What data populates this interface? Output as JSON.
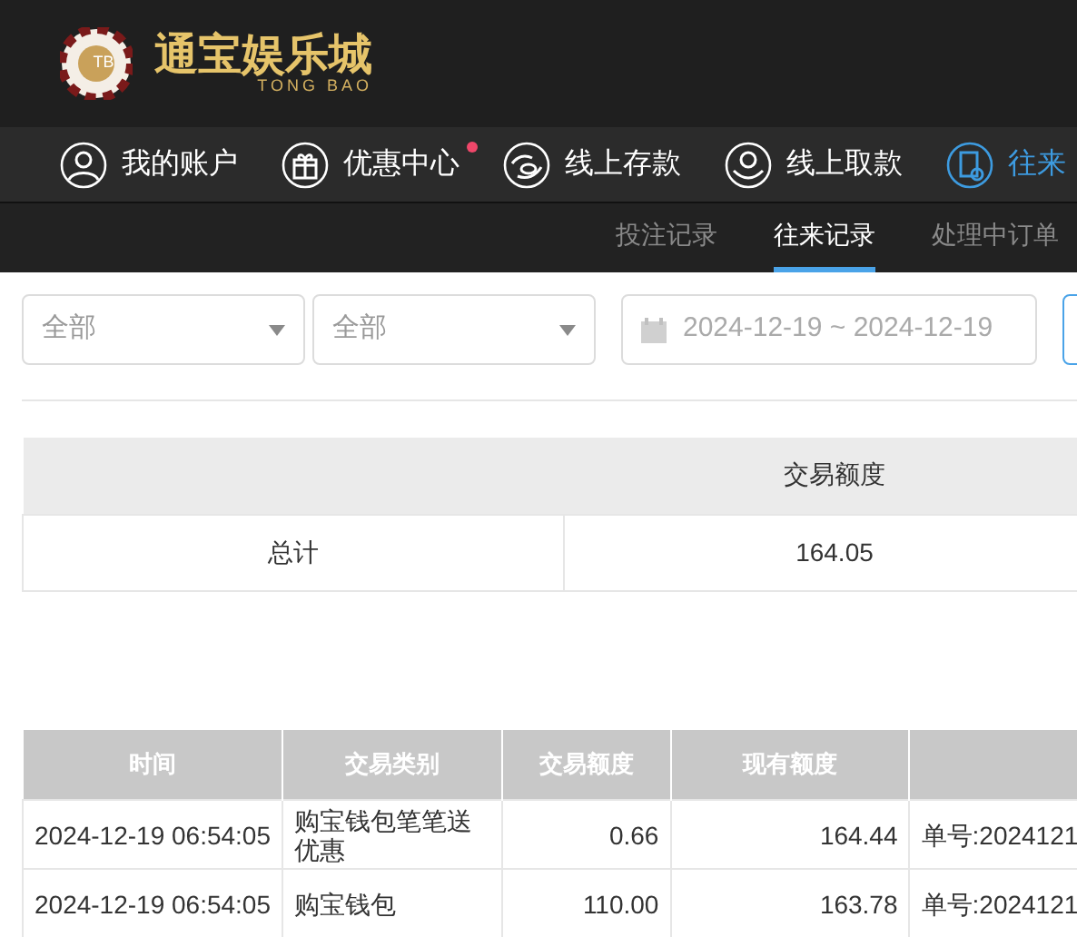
{
  "logo": {
    "badge": "TB",
    "title": "通宝娱乐城",
    "subtitle": "TONG BAO"
  },
  "nav": [
    {
      "label": "我的账户",
      "kind": "user",
      "selected": false,
      "dot": false
    },
    {
      "label": "优惠中心",
      "kind": "gift",
      "selected": false,
      "dot": true
    },
    {
      "label": "线上存款",
      "kind": "deposit",
      "selected": false,
      "dot": false
    },
    {
      "label": "线上取款",
      "kind": "withdraw",
      "selected": false,
      "dot": false
    },
    {
      "label": "往来",
      "kind": "records",
      "selected": true,
      "dot": false
    }
  ],
  "subtabs": [
    {
      "label": "投注记录",
      "selected": false
    },
    {
      "label": "往来记录",
      "selected": true
    },
    {
      "label": "处理中订单",
      "selected": false
    }
  ],
  "filters": {
    "select_1": "全部",
    "select_2": "全部",
    "date_range": "2024-12-19 ~ 2024-12-19"
  },
  "summary": {
    "columns": [
      "",
      "交易额度"
    ],
    "rows": [
      [
        "总计",
        "164.05"
      ]
    ]
  },
  "table": {
    "columns": [
      "时间",
      "交易类别",
      "交易额度",
      "现有额度",
      ""
    ],
    "rows": [
      [
        "2024-12-19 06:54:05",
        "购宝钱包笔笔送优惠",
        "0.66",
        "164.44",
        "单号:2024121"
      ],
      [
        "2024-12-19 06:54:05",
        "购宝钱包",
        "110.00",
        "163.78",
        "单号:2024121"
      ]
    ]
  }
}
